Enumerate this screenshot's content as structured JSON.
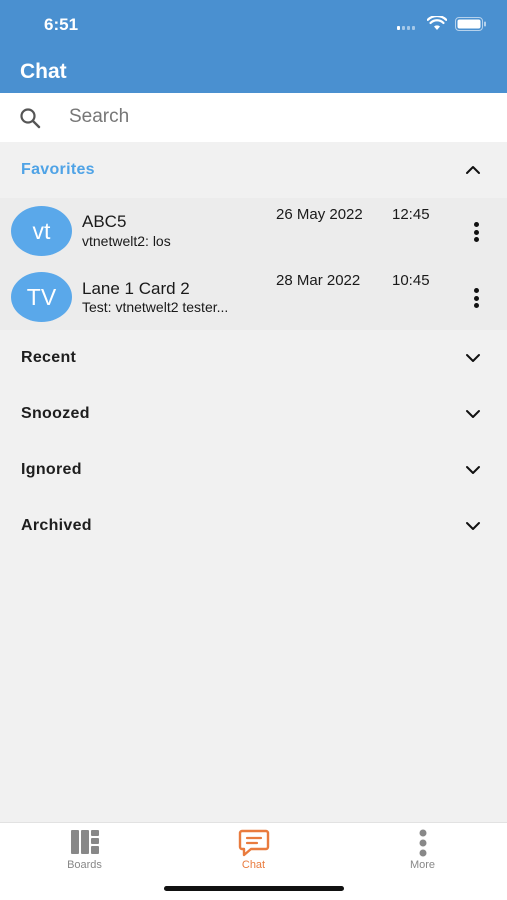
{
  "status": {
    "time": "6:51"
  },
  "header": {
    "title": "Chat"
  },
  "search": {
    "placeholder": "Search"
  },
  "favorites": {
    "label": "Favorites",
    "items": [
      {
        "avatar": "vt",
        "title": "ABC5",
        "preview": "vtnetwelt2: los",
        "date": "26 May 2022",
        "time": "12:45"
      },
      {
        "avatar": "TV",
        "title": "Lane 1 Card 2",
        "preview": "Test: vtnetwelt2 tester...",
        "date": "28 Mar 2022",
        "time": "10:45"
      }
    ]
  },
  "sections": [
    {
      "label": "Recent"
    },
    {
      "label": "Snoozed"
    },
    {
      "label": "Ignored"
    },
    {
      "label": "Archived"
    }
  ],
  "tabs": [
    {
      "label": "Boards",
      "icon": "boards-icon"
    },
    {
      "label": "Chat",
      "icon": "chat-icon",
      "active": true
    },
    {
      "label": "More",
      "icon": "more-vertical-icon"
    }
  ],
  "colors": {
    "header": "#4a90d0",
    "accent": "#e97b3e",
    "favorites": "#4fa3e6",
    "avatar": "#5aa8ea"
  }
}
